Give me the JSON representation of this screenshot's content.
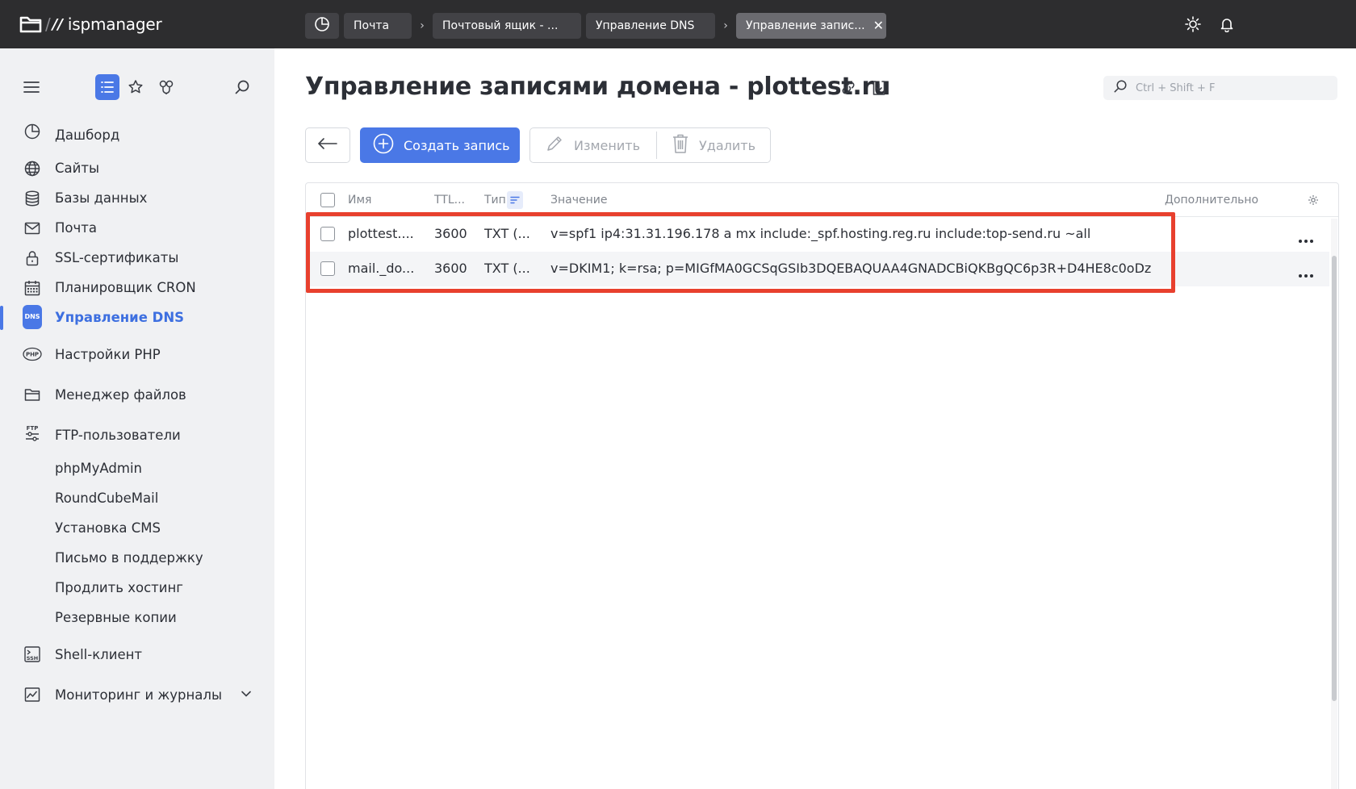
{
  "app": {
    "logo_text": "ispmanager",
    "logo_mark": "//"
  },
  "breadcrumbs": [
    {
      "label": "Почта"
    },
    {
      "label": "Почтовый ящик - ..."
    },
    {
      "label": "Управление DNS"
    },
    {
      "label": "Управление запис..."
    }
  ],
  "sidebar": {
    "items": [
      {
        "label": "Дашборд",
        "icon": "dashboard-icon"
      },
      {
        "label": "Сайты",
        "icon": "globe-icon"
      },
      {
        "label": "Базы данных",
        "icon": "database-icon"
      },
      {
        "label": "Почта",
        "icon": "mail-icon"
      },
      {
        "label": "SSL-сертификаты",
        "icon": "lock-icon"
      },
      {
        "label": "Планировщик CRON",
        "icon": "calendar-icon"
      },
      {
        "label": "Управление DNS",
        "icon": "dns-icon",
        "badge": "DNS"
      },
      {
        "label": "Настройки PHP",
        "icon": "php-icon",
        "badge": "PHP"
      },
      {
        "label": "Менеджер файлов",
        "icon": "folder-icon"
      },
      {
        "label": "FTP-пользователи",
        "icon": "ftp-icon",
        "badge": "FTP"
      },
      {
        "label": "phpMyAdmin"
      },
      {
        "label": "RoundCubeMail"
      },
      {
        "label": "Установка CMS"
      },
      {
        "label": "Письмо в поддержку"
      },
      {
        "label": "Продлить хостинг"
      },
      {
        "label": "Резервные копии"
      },
      {
        "label": "Shell-клиент",
        "icon": "ssh-icon",
        "badge": "SSH"
      },
      {
        "label": "Мониторинг и журналы",
        "icon": "monitoring-icon"
      }
    ]
  },
  "main": {
    "title": "Управление записями домена - plottest.ru",
    "search_placeholder": "Ctrl + Shift + F",
    "toolbar": {
      "create_label": "Создать запись",
      "edit_label": "Изменить",
      "delete_label": "Удалить"
    },
    "table": {
      "columns": {
        "name": "Имя",
        "ttl": "TTL...",
        "type": "Тип",
        "value": "Значение",
        "extra": "Дополнительно"
      },
      "rows": [
        {
          "name": "plottest....",
          "ttl": "3600",
          "type": "TXT (...",
          "value": "v=spf1 ip4:31.31.196.178 a mx include:_spf.hosting.reg.ru include:top-send.ru ~all"
        },
        {
          "name": "mail._do...",
          "ttl": "3600",
          "type": "TXT (...",
          "value": "v=DKIM1; k=rsa; p=MIGfMA0GCSqGSIb3DQEBAQUAA4GNADCBiQKBgQC6p3R+D4HE8c0oDz..."
        }
      ]
    }
  },
  "colors": {
    "accent": "#4a78e6",
    "topbar": "#2d2d2f",
    "highlight": "#e8402e"
  }
}
